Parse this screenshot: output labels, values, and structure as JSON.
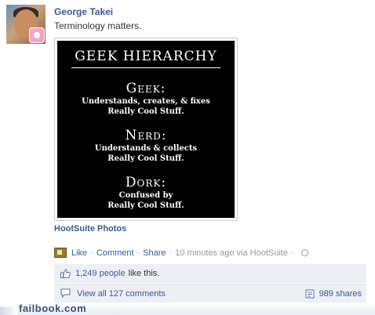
{
  "post": {
    "author": "George Takei",
    "message": "Terminology matters.",
    "poster": {
      "title": "GEEK HIERARCHY",
      "entries": [
        {
          "term": "Geek:",
          "desc1": "Understands, creates, & fixes",
          "desc2": "Really Cool Stuff."
        },
        {
          "term": "Nerd:",
          "desc1": "Understands & collects",
          "desc2": "Really Cool Stuff."
        },
        {
          "term": "Dork:",
          "desc1": "Confused by",
          "desc2": "Really Cool Stuff."
        }
      ]
    },
    "photo_caption": "HootSuite Photos",
    "actions": {
      "like": "Like",
      "comment": "Comment",
      "share": "Share",
      "separator": "·",
      "timestamp": "10 minutes ago via HootSuite"
    },
    "likes": {
      "count": "1,249 people",
      "suffix": "like this."
    },
    "comments": {
      "view_all": "View all 127 comments",
      "shares": "989 shares"
    }
  },
  "watermark": "failbook.com",
  "colors": {
    "link": "#3b5998",
    "meta": "#999999",
    "box": "#edeff4"
  }
}
